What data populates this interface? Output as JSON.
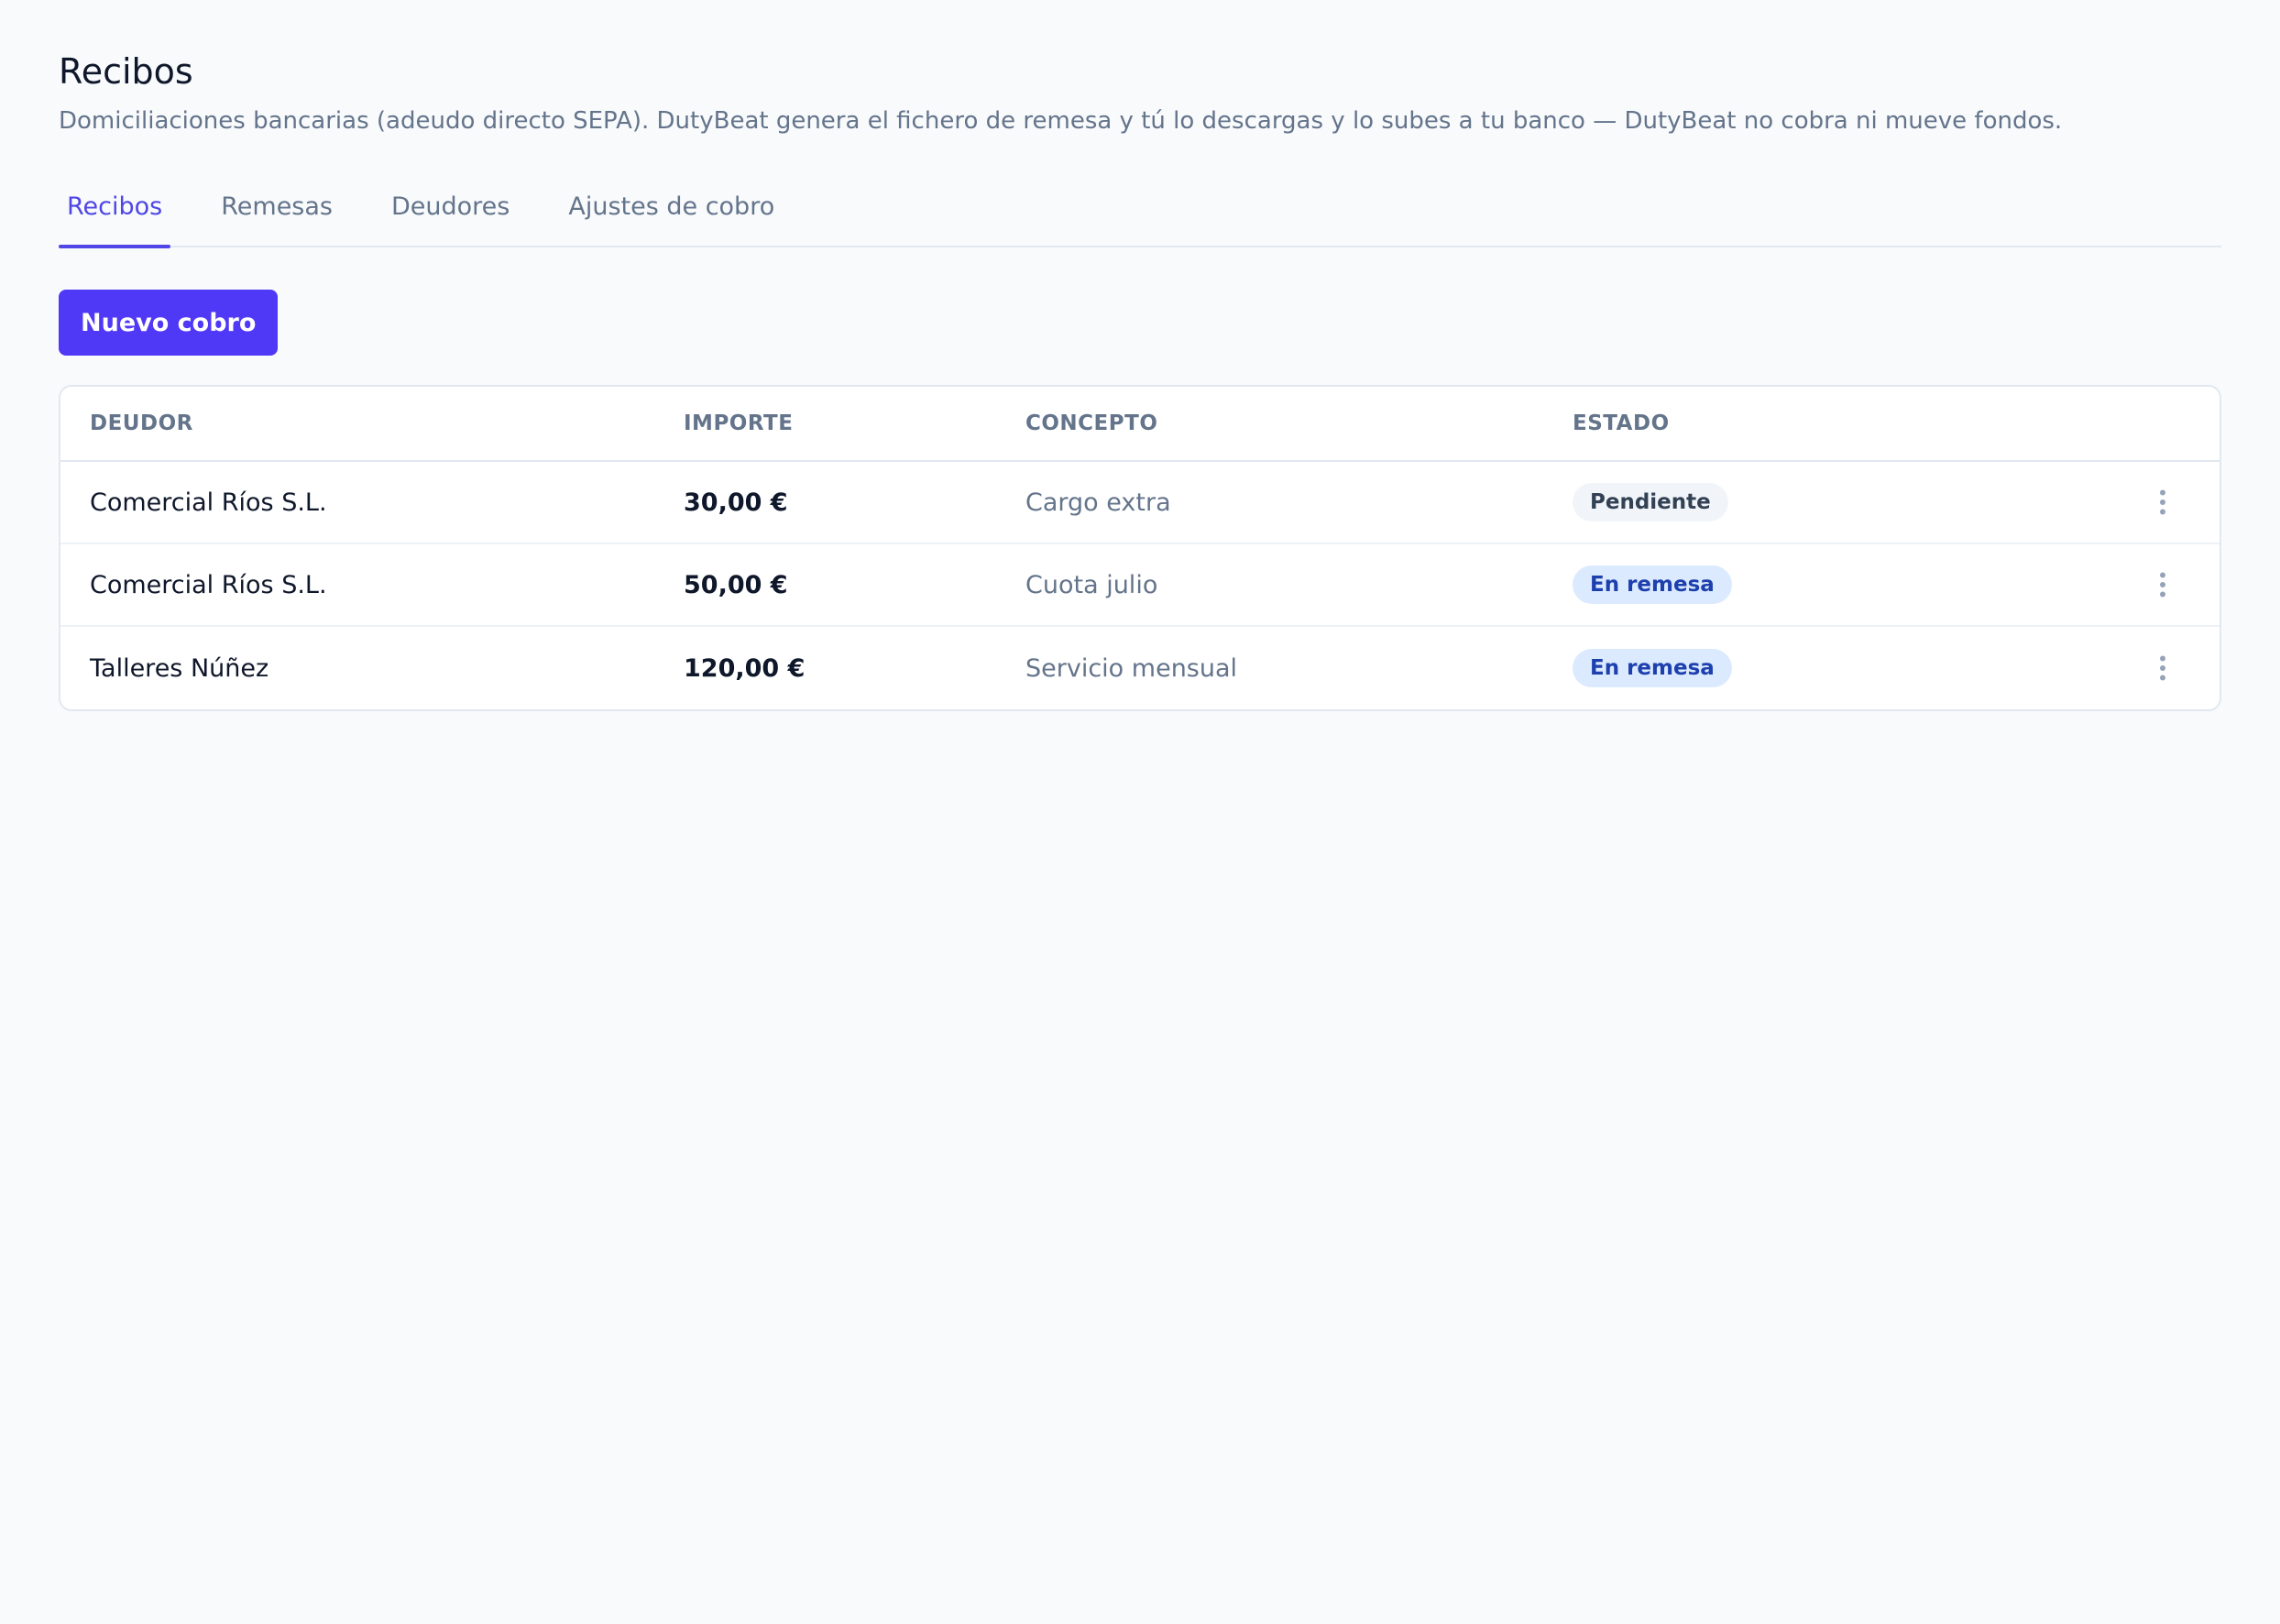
{
  "header": {
    "title": "Recibos",
    "subtitle": "Domiciliaciones bancarias (adeudo directo SEPA). DutyBeat genera el fichero de remesa y tú lo descargas y lo subes a tu banco — DutyBeat no cobra ni mueve fondos."
  },
  "tabs": [
    {
      "label": "Recibos",
      "active": true
    },
    {
      "label": "Remesas",
      "active": false
    },
    {
      "label": "Deudores",
      "active": false
    },
    {
      "label": "Ajustes de cobro",
      "active": false
    }
  ],
  "actions": {
    "new_charge_label": "Nuevo cobro"
  },
  "table": {
    "columns": [
      "DEUDOR",
      "IMPORTE",
      "CONCEPTO",
      "ESTADO"
    ],
    "rows": [
      {
        "debtor": "Comercial Ríos S.L.",
        "amount": "30,00 €",
        "concept": "Cargo extra",
        "status": "Pendiente",
        "status_type": "pending"
      },
      {
        "debtor": "Comercial Ríos S.L.",
        "amount": "50,00 €",
        "concept": "Cuota julio",
        "status": "En remesa",
        "status_type": "remesa"
      },
      {
        "debtor": "Talleres Núñez",
        "amount": "120,00 €",
        "concept": "Servicio mensual",
        "status": "En remesa",
        "status_type": "remesa"
      }
    ]
  },
  "icons": {
    "row_menu": "more-vertical-icon"
  },
  "colors": {
    "accent": "#4f46e5",
    "button": "#4f38f6",
    "badge_pending_bg": "#f1f5f9",
    "badge_remesa_bg": "#dbeafe",
    "badge_remesa_text": "#1e40af"
  }
}
